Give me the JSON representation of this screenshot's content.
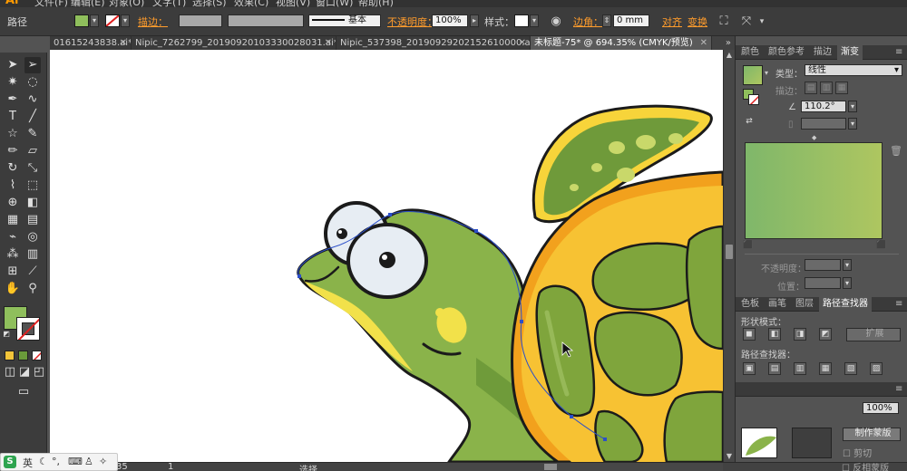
{
  "menubar": {
    "logo": "Ai",
    "items": [
      "文件(F)",
      "编辑(E)",
      "对象(O)",
      "文字(T)",
      "选择(S)",
      "效果(C)",
      "视图(V)",
      "窗口(W)",
      "帮助(H)"
    ]
  },
  "controlbar": {
    "object_type": "路径",
    "stroke_label": "描边：",
    "stroke_style": "基本",
    "opacity_label": "不透明度：",
    "opacity_value": "100%",
    "style_label": "样式：",
    "corner_label": "边角：",
    "corner_value": "0 mm",
    "align_label": "对齐",
    "transform_label": "变换"
  },
  "tabs": [
    {
      "label": "01615243838.ai*",
      "active": false
    },
    {
      "label": "Nipic_7262799_20190920103330028031.ai*",
      "active": false
    },
    {
      "label": "Nipic_537398_20190929202152610000.ai*",
      "active": false
    },
    {
      "label": "未标题-75* @ 694.35% (CMYK/预览)",
      "active": true
    }
  ],
  "gradient_panel": {
    "tabs": [
      "颜色",
      "颜色参考",
      "描边",
      "渐变"
    ],
    "active_tab": "渐变",
    "type_label": "类型：",
    "type_value": "线性",
    "stroke_label": "描边：",
    "angle_value": "110.2°",
    "opacity_label": "不透明度：",
    "position_label": "位置：",
    "gradient_start": "#7fb76a",
    "gradient_end": "#aec660"
  },
  "pathfinder_panel": {
    "tabs": [
      "色板",
      "画笔",
      "图层",
      "路径查找器"
    ],
    "active_tab": "路径查找器",
    "shape_modes_label": "形状模式：",
    "pathfinder_label": "路径查找器：",
    "expand_label": "扩展"
  },
  "transparency_panel": {
    "opacity_value": "100%",
    "make_mask_label": "制作蒙版",
    "clip_label": "剪切",
    "invert_label": "反相蒙版"
  },
  "statusbar": {
    "zoom": "35",
    "page": "1",
    "tool": "选择"
  },
  "ime": {
    "brand": "S",
    "mode": "英"
  },
  "colors": {
    "fill": "#8fbf5c",
    "turtle_light": "#8ab34a",
    "turtle_dark": "#4e7a2a",
    "shell_orange": "#f2a11d",
    "shell_yellow": "#f7d43a",
    "accent_orange": "#ff9c2c"
  }
}
